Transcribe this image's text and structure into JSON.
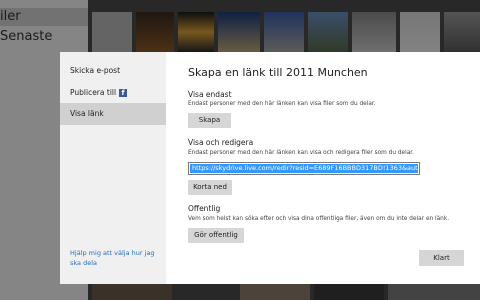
{
  "background": {
    "nav": [
      "iler",
      "Senaste"
    ]
  },
  "dialog": {
    "nav": {
      "send_email": "Skicka e-post",
      "publish_to": "Publicera till",
      "facebook_icon": "f",
      "show_link": "Visa länk",
      "help": "Hjälp mig att välja hur jag ska dela"
    },
    "title": "Skapa en länk till 2011 Munchen",
    "view_only": {
      "heading": "Visa endast",
      "desc": "Endast personer med den här länken kan visa filer som du delar.",
      "button": "Skapa"
    },
    "view_edit": {
      "heading": "Visa och redigera",
      "desc": "Endast personer med den här länken kan visa och redigera filer som du delar.",
      "link": "https://skydrive.live.com/redir?resid=E689F16BBBD317BD!1363&authk",
      "shorten": "Korta ned"
    },
    "public": {
      "heading": "Offentlig",
      "desc": "Vem som helst kan söka efter och visa dina offentliga filer, även om du inte delar en länk.",
      "button": "Gör offentlig"
    },
    "close": "Klart"
  }
}
